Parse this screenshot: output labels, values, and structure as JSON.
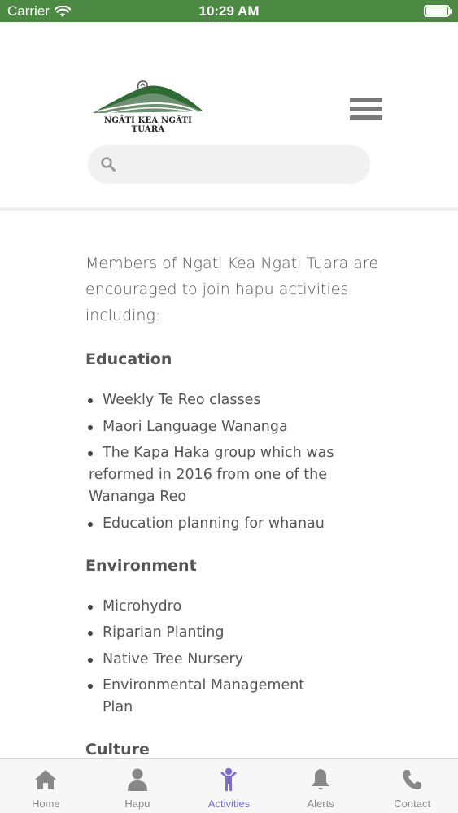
{
  "status_bar": {
    "carrier": "Carrier",
    "time": "10:29 AM",
    "battery_level_pct": 100,
    "background_color": "#4c8a43"
  },
  "header": {
    "logo_text": "NGĀTI KEA NGĀTI TUARA",
    "menu_icon": "hamburger-icon",
    "search": {
      "placeholder": "",
      "value": "",
      "icon": "search-icon"
    }
  },
  "content": {
    "intro": "Members of Ngati Kea Ngati Tuara are encouraged to join hapu activities including:",
    "sections": [
      {
        "title": "Education",
        "items": [
          "Weekly Te Reo classes",
          "Maori Language Wananga",
          "The Kapa Haka group which was reformed in 2016 from one of the Wananga Reo",
          "Education planning for whanau"
        ]
      },
      {
        "title": "Environment",
        "items": [
          "Microhydro",
          "Riparian Planting",
          "Native Tree Nursery",
          "Environmental Management Plan"
        ]
      },
      {
        "title": "Culture",
        "items": []
      }
    ]
  },
  "tabbar": {
    "active_color": "#7b6fd0",
    "inactive_color": "#888888",
    "tabs": [
      {
        "label": "Home",
        "icon": "home-icon",
        "active": false
      },
      {
        "label": "Hapu",
        "icon": "person-icon",
        "active": false
      },
      {
        "label": "Activities",
        "icon": "child-icon",
        "active": true
      },
      {
        "label": "Alerts",
        "icon": "bell-icon",
        "active": false
      },
      {
        "label": "Contact",
        "icon": "phone-icon",
        "active": false
      }
    ]
  }
}
